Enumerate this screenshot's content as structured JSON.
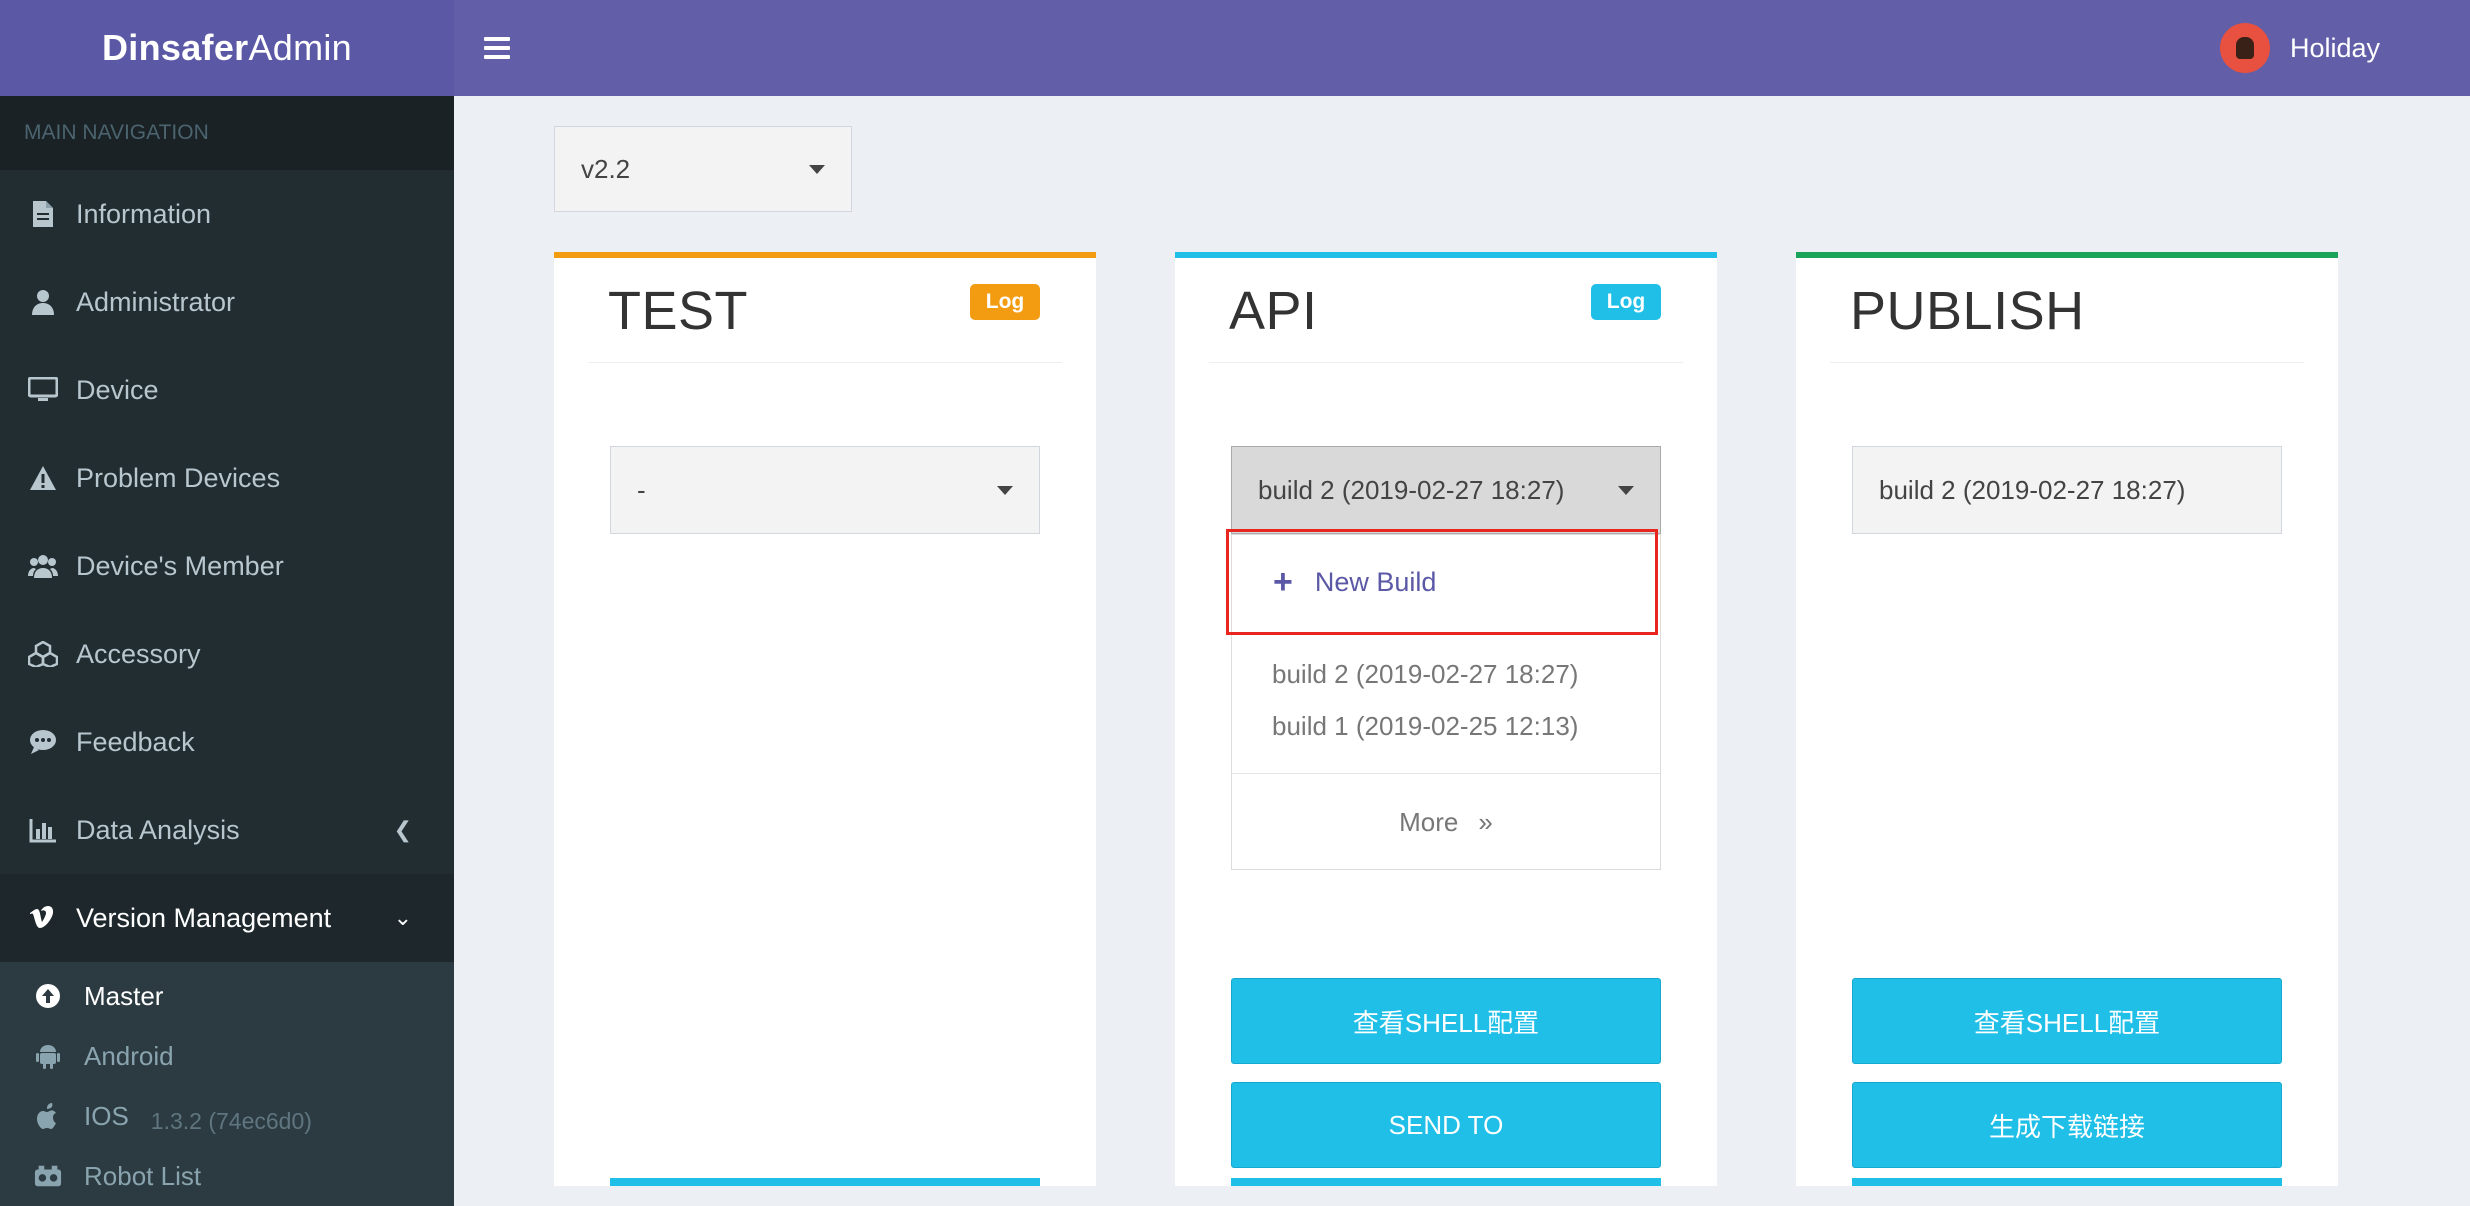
{
  "header": {
    "brand_bold": "Dinsafer",
    "brand_light": "Admin",
    "user_name": "Holiday"
  },
  "sidebar": {
    "section_label": "MAIN NAVIGATION",
    "items": [
      {
        "label": "Information",
        "icon": "document-icon"
      },
      {
        "label": "Administrator",
        "icon": "user-icon"
      },
      {
        "label": "Device",
        "icon": "monitor-icon"
      },
      {
        "label": "Problem Devices",
        "icon": "warning-icon"
      },
      {
        "label": "Device's Member",
        "icon": "users-icon"
      },
      {
        "label": "Accessory",
        "icon": "cubes-icon"
      },
      {
        "label": "Feedback",
        "icon": "chat-icon"
      },
      {
        "label": "Data Analysis",
        "icon": "bar-chart-icon"
      },
      {
        "label": "Version Management",
        "icon": "vimeo-icon"
      }
    ],
    "submenu": [
      {
        "label": "Master",
        "icon": "arrow-up-circle-icon"
      },
      {
        "label": "Android",
        "icon": "android-icon"
      },
      {
        "label": "IOS",
        "icon": "apple-icon",
        "extra": "1.3.2 (74ec6d0)"
      },
      {
        "label": "Robot List",
        "icon": "robot-icon"
      }
    ]
  },
  "version_select": {
    "value": "v2.2"
  },
  "cards": {
    "test": {
      "title": "TEST",
      "badge": "Log",
      "select_value": "-"
    },
    "api": {
      "title": "API",
      "badge": "Log",
      "select_value": "build 2 (2019-02-27 18:27)",
      "dropdown": {
        "new_build": "New Build",
        "options": [
          "build 2 (2019-02-27 18:27)",
          "build 1 (2019-02-25 12:13)"
        ],
        "more": "More"
      },
      "buttons": [
        "查看SHELL配置",
        "SEND TO"
      ]
    },
    "publish": {
      "title": "PUBLISH",
      "select_value": "build 2 (2019-02-27 18:27)",
      "buttons": [
        "查看SHELL配置",
        "生成下载链接"
      ]
    }
  },
  "colors": {
    "header": "#625ea8",
    "sidebar": "#222d32",
    "test_border": "#f39c12",
    "api_border": "#1fbfe8",
    "publish_border": "#1aa45a",
    "highlight": "#e8261f"
  }
}
